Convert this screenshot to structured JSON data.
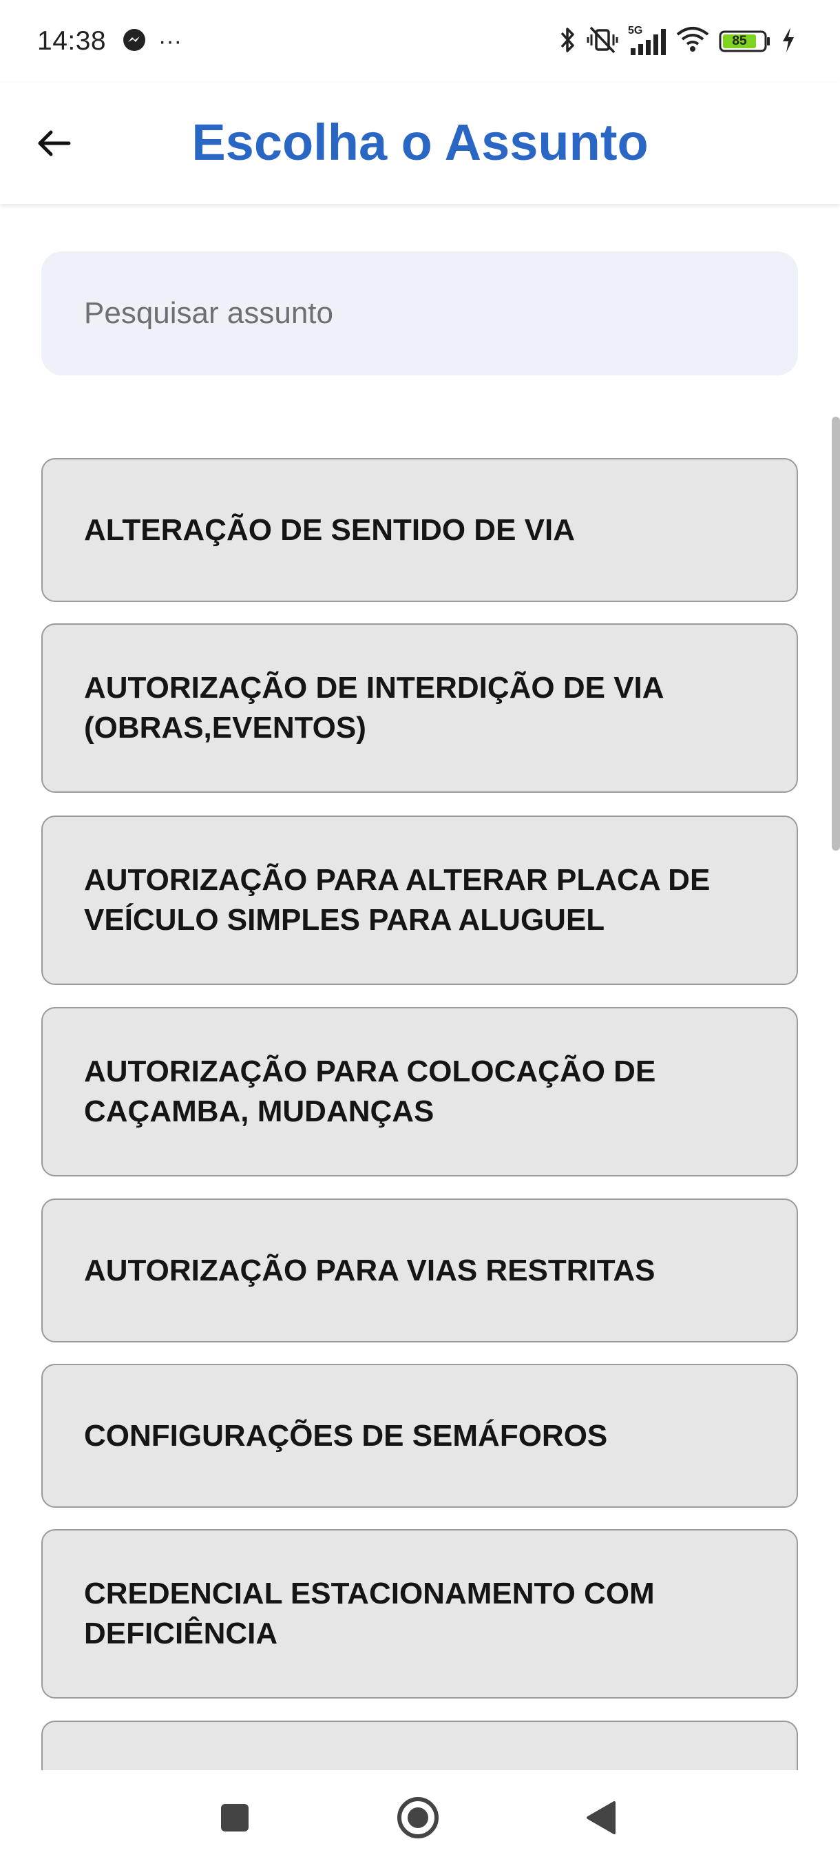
{
  "status_bar": {
    "time": "14:38",
    "more": "···",
    "network": "5G",
    "battery": "85",
    "icons": [
      "messenger-icon",
      "bluetooth-icon",
      "vibrate-off-icon",
      "signal-icon",
      "wifi-icon",
      "battery-icon",
      "charging-icon"
    ]
  },
  "header": {
    "title": "Escolha o Assunto",
    "back_icon": "arrow-left-icon",
    "title_color": "#2a66c4"
  },
  "search": {
    "placeholder": "Pesquisar assunto",
    "value": ""
  },
  "subjects": [
    "ALTERAÇÃO DE SENTIDO DE VIA",
    "AUTORIZAÇÃO DE INTERDIÇÃO DE VIA (OBRAS,EVENTOS)",
    "AUTORIZAÇÃO PARA ALTERAR PLACA DE VEÍCULO SIMPLES PARA ALUGUEL",
    "AUTORIZAÇÃO PARA COLOCAÇÃO DE CAÇAMBA, MUDANÇAS",
    "AUTORIZAÇÃO PARA VIAS RESTRITAS",
    "CONFIGURAÇÕES DE SEMÁFOROS",
    "CREDENCIAL ESTACIONAMENTO COM DEFICIÊNCIA",
    ""
  ],
  "nav_bar": {
    "icons": [
      "recents-square-icon",
      "home-circle-icon",
      "back-triangle-icon"
    ]
  }
}
